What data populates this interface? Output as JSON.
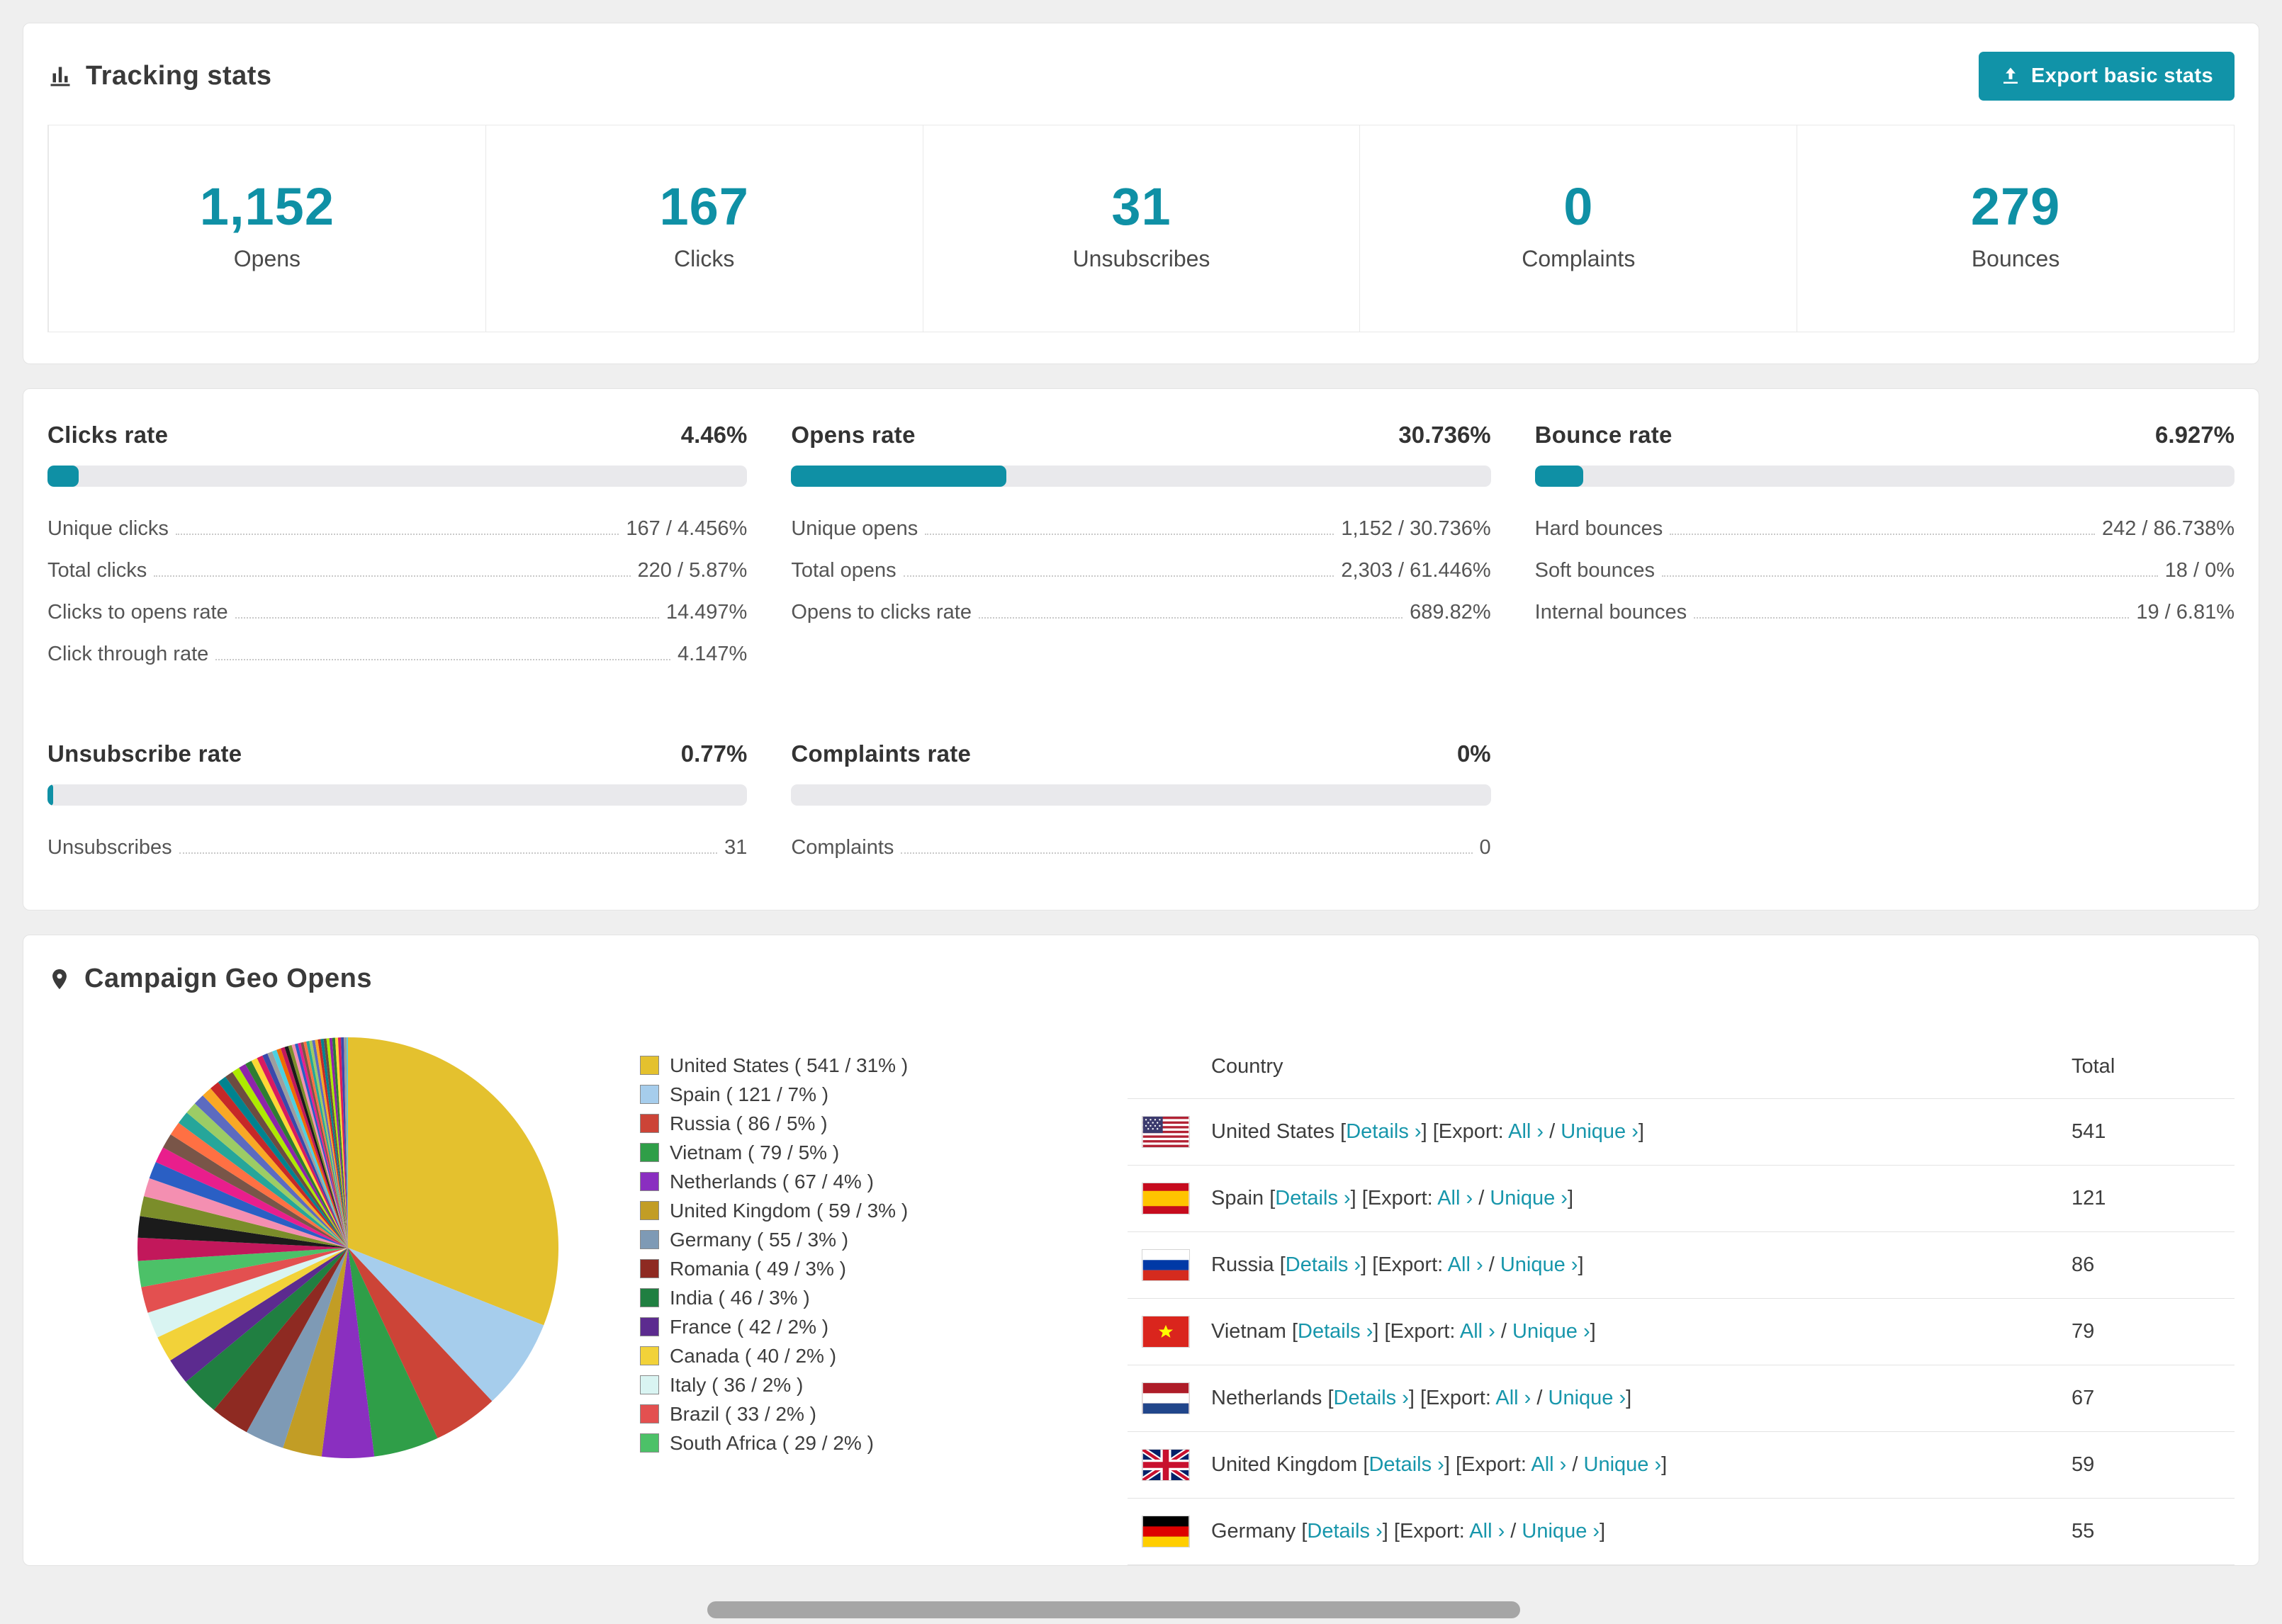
{
  "accent": "#0f90a5",
  "tracking": {
    "title": "Tracking stats",
    "export_button": "Export basic stats"
  },
  "stats": [
    {
      "value": "1,152",
      "label": "Opens"
    },
    {
      "value": "167",
      "label": "Clicks"
    },
    {
      "value": "31",
      "label": "Unsubscribes"
    },
    {
      "value": "0",
      "label": "Complaints"
    },
    {
      "value": "279",
      "label": "Bounces"
    }
  ],
  "rates": {
    "clicks": {
      "title": "Clicks rate",
      "value": "4.46%",
      "bar_pct": 4.46,
      "rows": [
        {
          "label": "Unique clicks",
          "value": "167 / 4.456%"
        },
        {
          "label": "Total clicks",
          "value": "220 / 5.87%"
        },
        {
          "label": "Clicks to opens rate",
          "value": "14.497%"
        },
        {
          "label": "Click through rate",
          "value": "4.147%"
        }
      ]
    },
    "opens": {
      "title": "Opens rate",
      "value": "30.736%",
      "bar_pct": 30.736,
      "rows": [
        {
          "label": "Unique opens",
          "value": "1,152 / 30.736%"
        },
        {
          "label": "Total opens",
          "value": "2,303 / 61.446%"
        },
        {
          "label": "Opens to clicks rate",
          "value": "689.82%"
        }
      ]
    },
    "bounce": {
      "title": "Bounce rate",
      "value": "6.927%",
      "bar_pct": 6.927,
      "rows": [
        {
          "label": "Hard bounces",
          "value": "242 / 86.738%"
        },
        {
          "label": "Soft bounces",
          "value": "18 / 0%"
        },
        {
          "label": "Internal bounces",
          "value": "19 / 6.81%"
        }
      ]
    },
    "unsubscribe": {
      "title": "Unsubscribe rate",
      "value": "0.77%",
      "bar_pct": 0.77,
      "rows": [
        {
          "label": "Unsubscribes",
          "value": "31"
        }
      ]
    },
    "complaints": {
      "title": "Complaints rate",
      "value": "0%",
      "bar_pct": 0,
      "rows": [
        {
          "label": "Complaints",
          "value": "0"
        }
      ]
    }
  },
  "geo": {
    "title": "Campaign Geo Opens",
    "legend": [
      {
        "text": "United States ( 541 / 31% )",
        "color": "#e4c12e"
      },
      {
        "text": "Spain ( 121 / 7% )",
        "color": "#a6cdec"
      },
      {
        "text": "Russia ( 86 / 5% )",
        "color": "#cc4437"
      },
      {
        "text": "Vietnam ( 79 / 5% )",
        "color": "#2f9e48"
      },
      {
        "text": "Netherlands ( 67 / 4% )",
        "color": "#8a2fc0"
      },
      {
        "text": "United Kingdom ( 59 / 3% )",
        "color": "#c29d25"
      },
      {
        "text": "Germany ( 55 / 3% )",
        "color": "#7e9ab5"
      },
      {
        "text": "Romania ( 49 / 3% )",
        "color": "#8e2a22"
      },
      {
        "text": "India ( 46 / 3% )",
        "color": "#207f41"
      },
      {
        "text": "France ( 42 / 2% )",
        "color": "#5c2b8f"
      },
      {
        "text": "Canada ( 40 / 2% )",
        "color": "#f2d239"
      },
      {
        "text": "Italy ( 36 / 2% )",
        "color": "#d9f4f2"
      },
      {
        "text": "Brazil ( 33 / 2% )",
        "color": "#e35050"
      },
      {
        "text": "South Africa ( 29 / 2% )",
        "color": "#4cc168"
      }
    ],
    "table": {
      "country_header": "Country",
      "total_header": "Total",
      "details_label": "Details ›",
      "export_label": "Export:",
      "all_label": "All ›",
      "unique_label": "Unique ›",
      "bracket_open": "[",
      "bracket_close": "]",
      "slash": "/",
      "rows": [
        {
          "flag": "us",
          "country": "United States",
          "total": "541"
        },
        {
          "flag": "es",
          "country": "Spain",
          "total": "121"
        },
        {
          "flag": "ru",
          "country": "Russia",
          "total": "86"
        },
        {
          "flag": "vn",
          "country": "Vietnam",
          "total": "79"
        },
        {
          "flag": "nl",
          "country": "Netherlands",
          "total": "67"
        },
        {
          "flag": "gb",
          "country": "United Kingdom",
          "total": "59"
        },
        {
          "flag": "de",
          "country": "Germany",
          "total": "55"
        }
      ]
    }
  },
  "chart_data": {
    "type": "pie",
    "title": "Campaign Geo Opens",
    "labels": [
      "United States",
      "Spain",
      "Russia",
      "Vietnam",
      "Netherlands",
      "United Kingdom",
      "Germany",
      "Romania",
      "India",
      "France",
      "Canada",
      "Italy",
      "Brazil",
      "South Africa"
    ],
    "values": [
      541,
      121,
      86,
      79,
      67,
      59,
      55,
      49,
      46,
      42,
      40,
      36,
      33,
      29
    ],
    "pct": [
      31,
      7,
      5,
      5,
      4,
      3,
      3,
      3,
      3,
      2,
      2,
      2,
      2,
      2
    ],
    "colors": [
      "#e4c12e",
      "#a6cdec",
      "#cc4437",
      "#2f9e48",
      "#8a2fc0",
      "#c29d25",
      "#7e9ab5",
      "#8e2a22",
      "#207f41",
      "#5c2b8f",
      "#f2d239",
      "#d9f4f2",
      "#e35050",
      "#4cc168"
    ],
    "others_pct_total": 26,
    "others_colors": [
      "#c2185b",
      "#1b1b1b",
      "#7b8d2a",
      "#f48fb1",
      "#2a5fc4",
      "#e91e8c",
      "#795548",
      "#ff7043",
      "#26a69a",
      "#9ccc65",
      "#5c6bc0",
      "#f9a825",
      "#c62828",
      "#00838f",
      "#6d4c41",
      "#aeea00",
      "#8e24aa",
      "#2e7d32",
      "#fdd835",
      "#d81b60",
      "#3949ab",
      "#9e9e9e",
      "#4dd0e1",
      "#ef6c00"
    ],
    "legend_position": "right",
    "start_angle_deg": -90,
    "direction": "clockwise"
  }
}
